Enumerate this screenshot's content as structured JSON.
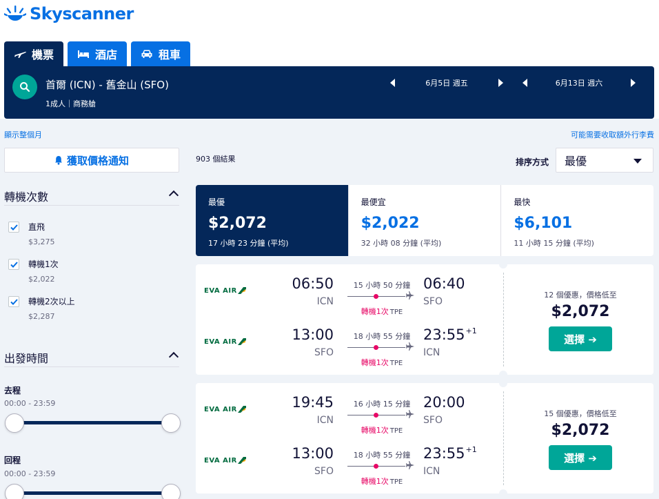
{
  "brand": {
    "name": "Skyscanner",
    "color": "#0770e3"
  },
  "tabs": [
    {
      "label": "機票",
      "icon": "plane-icon",
      "active": true
    },
    {
      "label": "酒店",
      "icon": "bed-icon",
      "active": false
    },
    {
      "label": "租車",
      "icon": "car-icon",
      "active": false
    }
  ],
  "search": {
    "route": "首爾 (ICN) - 舊金山 (SFO)",
    "passengers": "1成人｜商務艙",
    "depart_date": "6月5日 週五",
    "return_date": "6月13日 週六"
  },
  "links": {
    "whole_month": "顯示整個月",
    "baggage_fee": "可能需要收取額外行李費"
  },
  "sidebar": {
    "alert_button": "獲取價格通知",
    "stops_title": "轉機次數",
    "stops": [
      {
        "label": "直飛",
        "price": "$3,275",
        "checked": true
      },
      {
        "label": "轉機1次",
        "price": "$2,022",
        "checked": true
      },
      {
        "label": "轉機2次以上",
        "price": "$2,287",
        "checked": true
      }
    ],
    "time_title": "出發時間",
    "outbound_label": "去程",
    "outbound_range": "00:00 - 23:59",
    "return_label": "回程",
    "return_range": "00:00 - 23:59"
  },
  "results": {
    "count": "903 個結果",
    "sort_label": "排序方式",
    "sort_value": "最優"
  },
  "summary": [
    {
      "label": "最優",
      "price": "$2,072",
      "duration": "17 小時 23 分鐘 (平均)",
      "active": true
    },
    {
      "label": "最便宜",
      "price": "$2,022",
      "duration": "32 小時 08 分鐘 (平均)",
      "active": false
    },
    {
      "label": "最快",
      "price": "$6,101",
      "duration": "11 小時 15 分鐘 (平均)",
      "active": false
    }
  ],
  "flights": [
    {
      "legs": [
        {
          "airline": "EVA AIR",
          "dep_time": "06:50",
          "dep_code": "ICN",
          "duration": "15 小時 50 分鐘",
          "stops": "轉機1次",
          "via": "TPE",
          "arr_time": "06:40",
          "arr_code": "SFO",
          "arr_day": ""
        },
        {
          "airline": "EVA AIR",
          "dep_time": "13:00",
          "dep_code": "SFO",
          "duration": "18 小時 55 分鐘",
          "stops": "轉機1次",
          "via": "TPE",
          "arr_time": "23:55",
          "arr_code": "ICN",
          "arr_day": "+1"
        }
      ],
      "deal": "12 個優惠，價格低至",
      "price": "$2,072",
      "select_label": "選擇 ➔"
    },
    {
      "legs": [
        {
          "airline": "EVA AIR",
          "dep_time": "19:45",
          "dep_code": "ICN",
          "duration": "16 小時 15 分鐘",
          "stops": "轉機1次",
          "via": "TPE",
          "arr_time": "20:00",
          "arr_code": "SFO",
          "arr_day": ""
        },
        {
          "airline": "EVA AIR",
          "dep_time": "13:00",
          "dep_code": "SFO",
          "duration": "18 小時 55 分鐘",
          "stops": "轉機1次",
          "via": "TPE",
          "arr_time": "23:55",
          "arr_code": "ICN",
          "arr_day": "+1"
        }
      ],
      "deal": "15 個優惠，價格低至",
      "price": "$2,072",
      "select_label": "選擇 ➔"
    }
  ]
}
